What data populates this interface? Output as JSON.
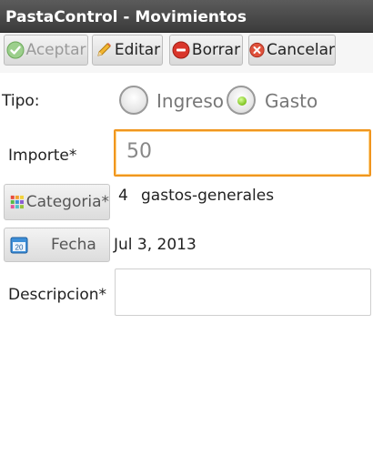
{
  "app": {
    "title": "PastaControl - Movimientos"
  },
  "toolbar": {
    "aceptar_label": "Aceptar",
    "editar_label": "Editar",
    "borrar_label": "Borrar",
    "cancelar_label": "Cancelar"
  },
  "form": {
    "tipo_label": "Tipo:",
    "tipo_options": [
      {
        "label": "Ingreso",
        "selected": false
      },
      {
        "label": "Gasto",
        "selected": true
      }
    ],
    "importe_label": "Importe*",
    "importe_value": "50",
    "categoria_button": "Categoria*",
    "categoria_id": "4",
    "categoria_name": "gastos-generales",
    "fecha_button": "Fecha",
    "fecha_value": "Jul 3, 2013",
    "descripcion_label": "Descripcion*",
    "descripcion_value": ""
  },
  "colors": {
    "focus_border": "#f0961e",
    "radio_selected": "#7dc21e",
    "accept_green": "#3fa02a",
    "delete_red": "#d9352a"
  },
  "icons": [
    "check-icon",
    "pencil-icon",
    "minus-circle-icon",
    "x-circle-icon",
    "grid-icon",
    "calendar-icon"
  ]
}
